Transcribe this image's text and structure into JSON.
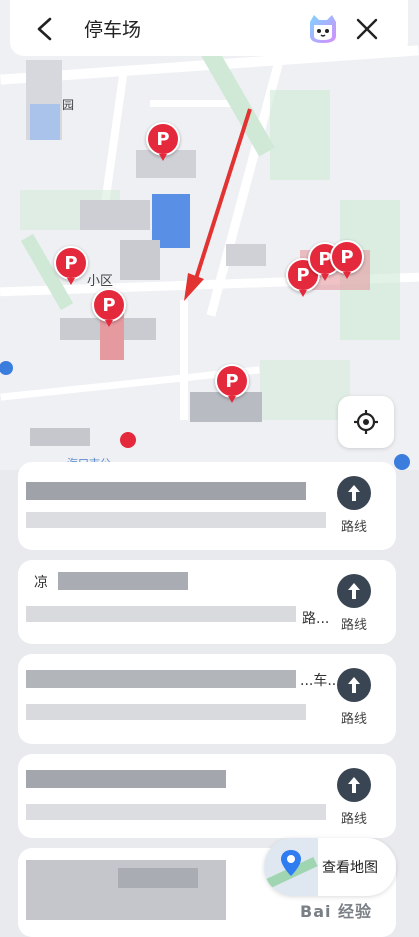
{
  "topbar": {
    "query": "停车场",
    "back_icon": "chevron-left-icon",
    "assistant_icon": "cat-mascot-icon",
    "close_icon": "close-icon"
  },
  "map": {
    "pins": [
      "P",
      "P",
      "P",
      "P",
      "P",
      "P",
      "P"
    ],
    "labels": {
      "road": "园",
      "area": "小区",
      "bottom": "海口市公"
    },
    "accent": "#e5293c"
  },
  "results": [
    {
      "peek_start": "",
      "peek_end": "",
      "route_label": "路线"
    },
    {
      "peek_start": "凉",
      "peek_end": "路...",
      "route_label": "路线"
    },
    {
      "peek_start": "",
      "peek_end": "...车...",
      "route_label": "路线"
    },
    {
      "peek_start": "",
      "peek_end": "",
      "route_label": "路线"
    },
    {
      "peek_start": "",
      "peek_end": "",
      "route_label": ""
    }
  ],
  "view_map": {
    "label": "查看地图",
    "icon": "map-pin-icon"
  },
  "watermark": "Bai 经验"
}
